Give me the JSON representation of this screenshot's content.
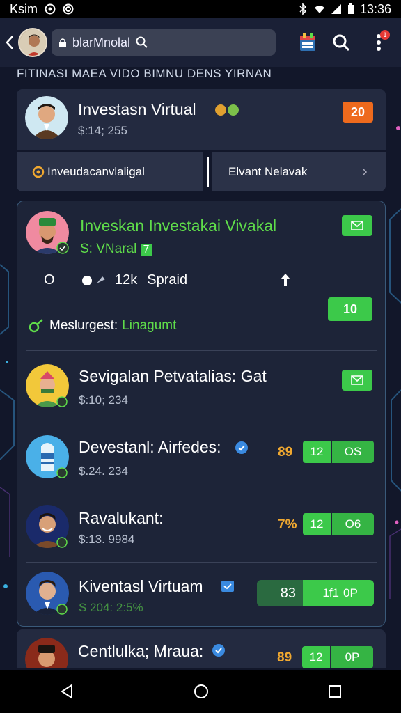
{
  "status_bar": {
    "carrier": "Ksim",
    "time": "13:36"
  },
  "app_bar": {
    "search_text": "blarMnolal"
  },
  "subheader": "FITINASI MAEA VIDO BIMNU DENS YIRNAN",
  "top_card": {
    "title": "Investasn Virtual",
    "subtitle": "$:14; 255",
    "badge": "20"
  },
  "tabs": [
    {
      "label": "Inveudacanvlaligal"
    },
    {
      "label": "Elvant Nelavak"
    }
  ],
  "featured": {
    "title": "Inveskan Investakai Vivakal",
    "subtitle": "S: VNaral",
    "subtitle_badge": "7",
    "stats": {
      "count": "O",
      "value": "12k",
      "label": "Spraid"
    },
    "button": "10",
    "meta_label": "Meslurgest:",
    "meta_value": "Linagumt"
  },
  "rows": [
    {
      "title": "Sevigalan Petvatalias: Gat",
      "subtitle": "$:10; 234",
      "pct": "",
      "left": "",
      "right": ""
    },
    {
      "title": "Devestanl: Airfedes:",
      "subtitle": "$.24. 234",
      "pct": "89",
      "left": "12",
      "right": "OS"
    },
    {
      "title": "Ravalukant:",
      "subtitle": "$:13. 9984",
      "pct": "7%",
      "left": "12",
      "right": "O6"
    },
    {
      "title": "Kiventasl Virtuam",
      "subtitle": "S 204: 2:5%",
      "pct": "83",
      "left": "1f1",
      "right": "0P"
    }
  ],
  "last_row": {
    "title": "Centlulka; Mraua:",
    "pct": "89",
    "left": "12",
    "right": "0P"
  },
  "colors": {
    "accent_green": "#3cc94a",
    "accent_orange": "#ee6a1d",
    "pct_color": "#f0a830"
  }
}
